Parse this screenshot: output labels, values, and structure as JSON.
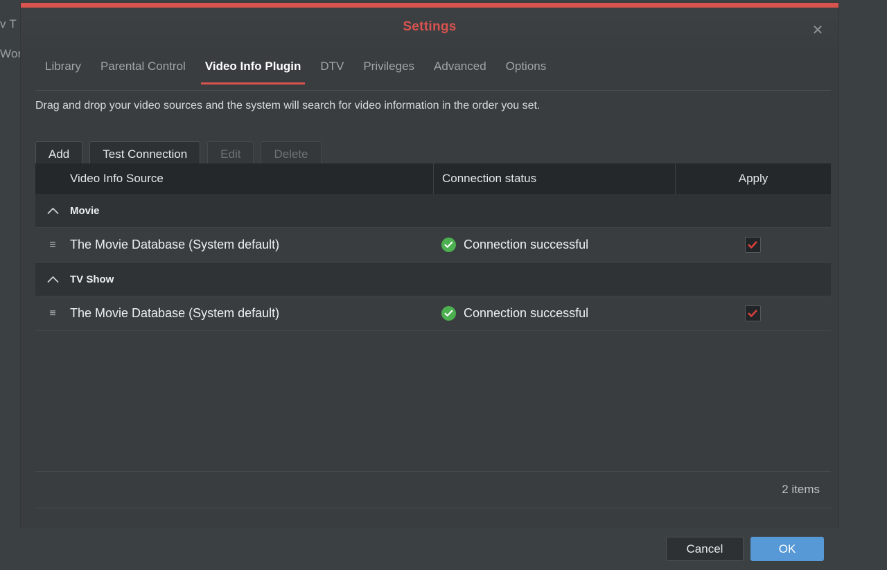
{
  "background": {
    "text_fragment_1": "v T",
    "text_fragment_2": "Wor"
  },
  "dialog": {
    "title": "Settings",
    "close_icon": "close-icon",
    "accent_color": "#d9534f"
  },
  "tabs": [
    {
      "label": "Library",
      "active": false
    },
    {
      "label": "Parental Control",
      "active": false
    },
    {
      "label": "Video Info Plugin",
      "active": true
    },
    {
      "label": "DTV",
      "active": false
    },
    {
      "label": "Privileges",
      "active": false
    },
    {
      "label": "Advanced",
      "active": false
    },
    {
      "label": "Options",
      "active": false
    }
  ],
  "main": {
    "description": "Drag and drop your video sources and the system will search for video information in the order you set.",
    "toolbar": [
      {
        "label": "Add",
        "disabled": false
      },
      {
        "label": "Test Connection",
        "disabled": false
      },
      {
        "label": "Edit",
        "disabled": true
      },
      {
        "label": "Delete",
        "disabled": true
      }
    ],
    "table": {
      "columns": [
        "Video Info Source",
        "Connection status",
        "Apply"
      ],
      "groups": [
        {
          "label": "Movie",
          "expanded": true,
          "rows": [
            {
              "source": "The Movie Database (System default)",
              "status": "Connection successful",
              "status_icon": "check-circle-icon",
              "status_color": "#4caf50",
              "apply_checked": true
            }
          ]
        },
        {
          "label": "TV Show",
          "expanded": true,
          "rows": [
            {
              "source": "The Movie Database (System default)",
              "status": "Connection successful",
              "status_icon": "check-circle-icon",
              "status_color": "#4caf50",
              "apply_checked": true
            }
          ]
        }
      ],
      "footer_count": "2 items"
    }
  },
  "footer": {
    "cancel_label": "Cancel",
    "ok_label": "OK",
    "ok_color": "#5699d6"
  }
}
